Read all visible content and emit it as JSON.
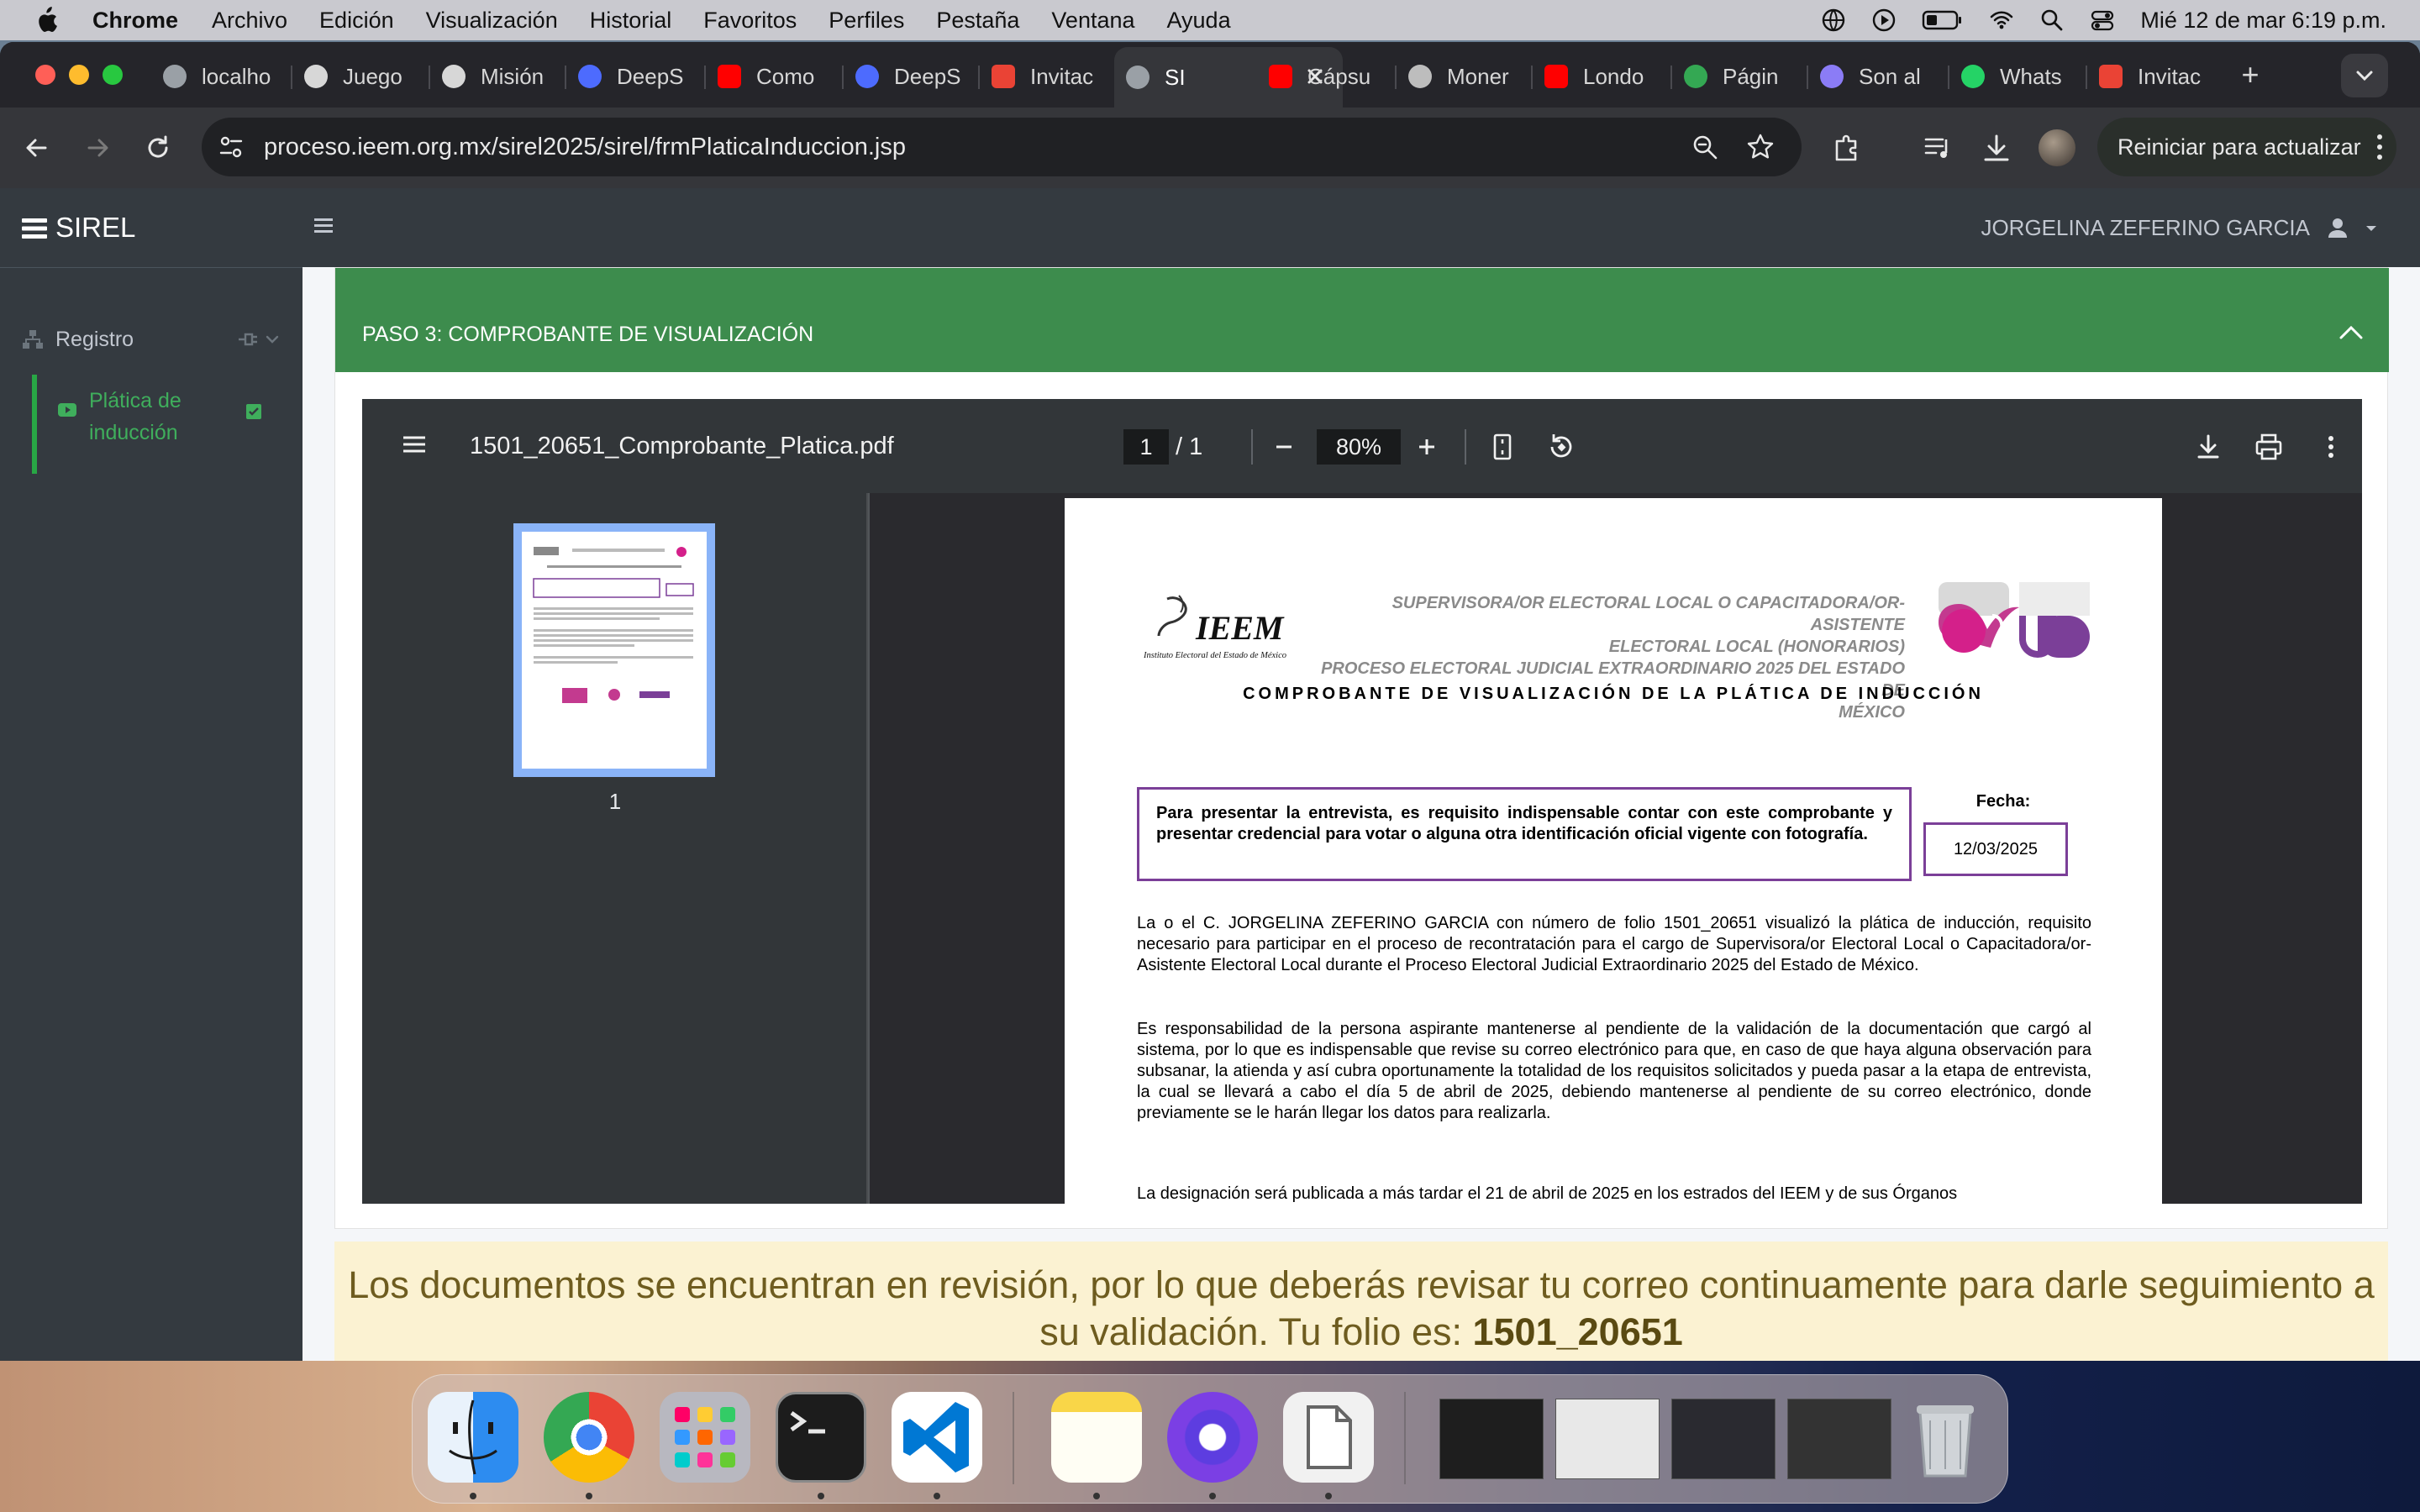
{
  "menubar": {
    "app": "Chrome",
    "items": [
      "Archivo",
      "Edición",
      "Visualización",
      "Historial",
      "Favoritos",
      "Perfiles",
      "Pestaña",
      "Ventana",
      "Ayuda"
    ],
    "clock": "Mié 12 de mar  6:19 p.m."
  },
  "tabs": [
    {
      "title": "localho",
      "icon": "globe-icon"
    },
    {
      "title": "Juego",
      "icon": "openai-icon"
    },
    {
      "title": "Misión",
      "icon": "openai-icon"
    },
    {
      "title": "DeepS",
      "icon": "deepseek-icon"
    },
    {
      "title": "Como",
      "icon": "youtube-icon"
    },
    {
      "title": "DeepS",
      "icon": "deepseek-icon"
    },
    {
      "title": "Invitac",
      "icon": "gmail-icon"
    },
    {
      "title": "SI",
      "icon": "globe-icon",
      "active": true
    },
    {
      "title": "Cápsu",
      "icon": "youtube-icon"
    },
    {
      "title": "Moner",
      "icon": "moneric-icon"
    },
    {
      "title": "Londo",
      "icon": "youtube-icon"
    },
    {
      "title": "Págin",
      "icon": "drive-icon"
    },
    {
      "title": "Son al",
      "icon": "gemini-icon"
    },
    {
      "title": "Whats",
      "icon": "whatsapp-icon"
    },
    {
      "title": "Invitac",
      "icon": "gmail-icon"
    }
  ],
  "toolbar": {
    "url": "proceso.ieem.org.mx/sirel2025/sirel/frmPlaticaInduccion.jsp",
    "restart_label": "Reiniciar para actualizar"
  },
  "app": {
    "brand": "SIREL",
    "user": "JORGELINA ZEFERINO GARCIA",
    "nav": {
      "registro": "Registro",
      "platica": "Plática de inducción"
    },
    "step_title": "PASO 3: COMPROBANTE DE VISUALIZACIÓN"
  },
  "pdf": {
    "filename": "1501_20651_Comprobante_Platica.pdf",
    "page": "1",
    "page_sep": "/",
    "total_pages": "1",
    "zoom": "80%",
    "thumb_label": "1"
  },
  "doc": {
    "logo_text": "IEEM",
    "logo_subtitle": "Instituto Electoral del Estado de México",
    "header_lines": [
      "SUPERVISORA/OR ELECTORAL LOCAL O CAPACITADORA/OR-ASISTENTE",
      "ELECTORAL LOCAL (HONORARIOS)",
      "PROCESO ELECTORAL JUDICIAL EXTRAORDINARIO 2025 DEL ESTADO DE",
      "MÉXICO"
    ],
    "title": "COMPROBANTE DE VISUALIZACIÓN DE LA PLÁTICA DE INDUCCIÓN",
    "requirement": "Para presentar la entrevista, es requisito indispensable contar con este comprobante y presentar credencial para votar o alguna otra identificación oficial vigente con fotografía.",
    "fecha_label": "Fecha:",
    "fecha_value": "12/03/2025",
    "para1": "La o el C. JORGELINA ZEFERINO GARCIA con número de folio 1501_20651 visualizó la plática de inducción, requisito necesario para participar en el proceso de recontratación para el cargo de Supervisora/or Electoral Local o Capacitadora/or-Asistente Electoral Local durante el Proceso Electoral Judicial Extraordinario 2025 del Estado de México.",
    "para2": "Es responsabilidad de la persona aspirante mantenerse al pendiente de la validación de la documentación que cargó al sistema, por lo que es indispensable que revise su correo electrónico para que, en caso de que haya alguna observación para subsanar, la atienda y así cubra oportunamente la totalidad de los requisitos solicitados y pueda pasar a la etapa de entrevista, la cual se llevará a cabo el día 5 de abril de 2025, debiendo mantenerse al pendiente de su correo electrónico, donde previamente se le harán llegar los datos para realizarla.",
    "para3": "La designación será publicada a más tardar el 21 de abril de 2025 en los estrados del IEEM y de sus Órganos"
  },
  "notice": {
    "text": "Los documentos se encuentran en revisión, por lo que deberás revisar tu correo continuamente para darle seguimiento a su validación. Tu folio es:",
    "folio": "1501_20651"
  },
  "colors": {
    "green_header": "#3d8c4d",
    "notice_bg": "#fbf2d2",
    "doc_border": "#7b3f98",
    "sidebar": "#343a40"
  },
  "dock": [
    "finder-icon",
    "chrome-icon",
    "launchpad-icon",
    "terminal-icon",
    "vscode-icon",
    "notes-icon",
    "screenrecorder-icon",
    "preview-icon",
    "trash-icon"
  ]
}
